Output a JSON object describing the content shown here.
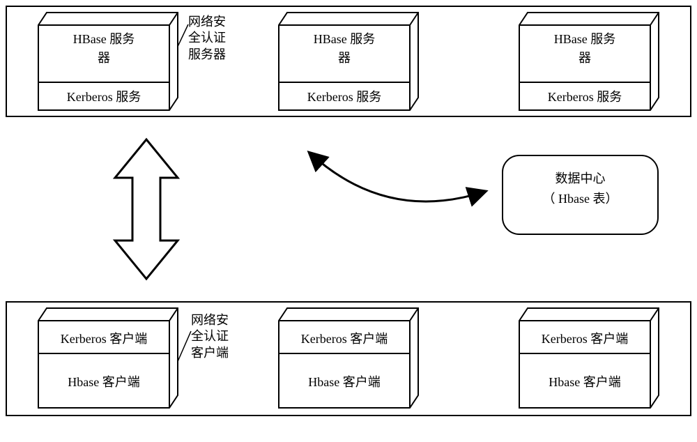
{
  "top_group": {
    "annotation": "网络安\n全认证\n服务器",
    "boxes": [
      {
        "top": "HBase 服务\n器",
        "bottom": "Kerberos 服务"
      },
      {
        "top": "HBase 服务\n器",
        "bottom": "Kerberos 服务"
      },
      {
        "top": "HBase 服务\n器",
        "bottom": "Kerberos 服务"
      }
    ]
  },
  "bottom_group": {
    "annotation": "网络安\n全认证\n客户端",
    "boxes": [
      {
        "top": "Kerberos 客户端",
        "bottom": "Hbase 客户端"
      },
      {
        "top": "Kerberos 客户端",
        "bottom": "Hbase 客户端"
      },
      {
        "top": "Kerberos 客户端",
        "bottom": "Hbase 客户端"
      }
    ]
  },
  "center": {
    "label_line1": "数据中心",
    "label_line2": "（ Hbase 表）"
  }
}
